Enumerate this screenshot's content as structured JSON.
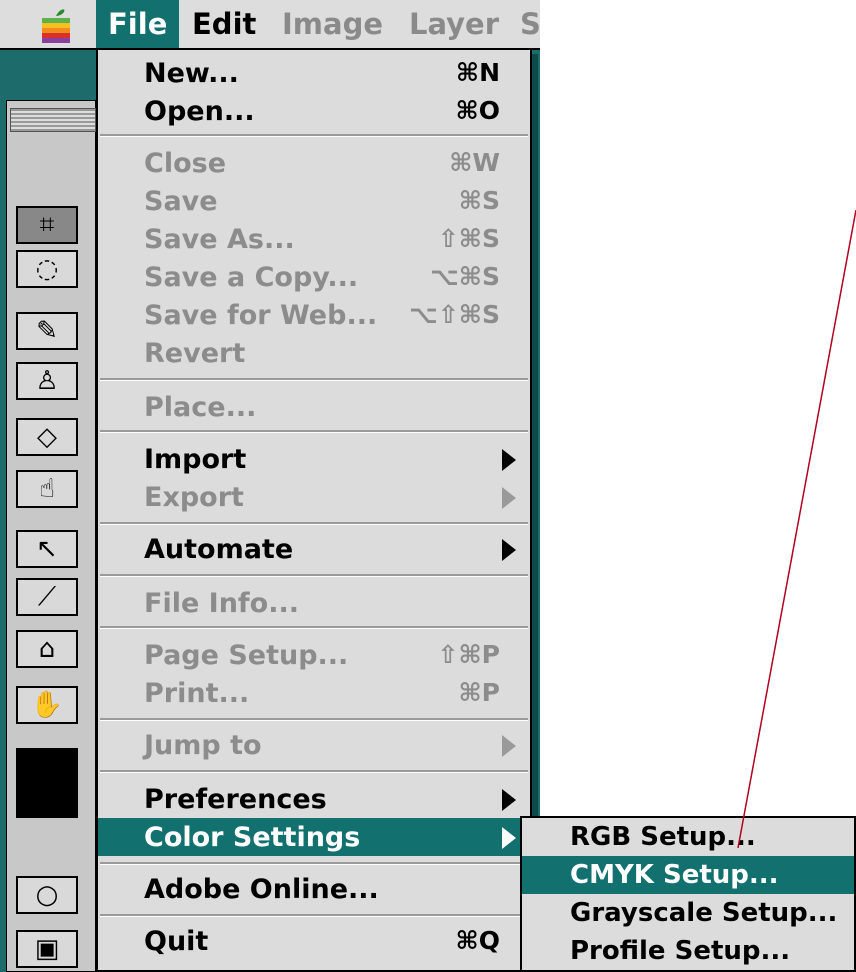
{
  "menubar": {
    "items": [
      {
        "label": "File",
        "state": "active"
      },
      {
        "label": "Edit",
        "state": "enabled"
      },
      {
        "label": "Image",
        "state": "dim"
      },
      {
        "label": "Layer",
        "state": "dim"
      },
      {
        "label": "S",
        "state": "dim"
      }
    ]
  },
  "file_menu": {
    "items": [
      {
        "label": "New...",
        "shortcut": "⌘N",
        "enabled": true
      },
      {
        "label": "Open...",
        "shortcut": "⌘O",
        "enabled": true
      },
      {
        "label": "Close",
        "shortcut": "⌘W",
        "enabled": false
      },
      {
        "label": "Save",
        "shortcut": "⌘S",
        "enabled": false
      },
      {
        "label": "Save As...",
        "shortcut": "⇧⌘S",
        "enabled": false
      },
      {
        "label": "Save a Copy...",
        "shortcut": "⌥⌘S",
        "enabled": false
      },
      {
        "label": "Save for Web...",
        "shortcut": "⌥⇧⌘S",
        "enabled": false
      },
      {
        "label": "Revert",
        "shortcut": "",
        "enabled": false
      },
      {
        "label": "Place...",
        "shortcut": "",
        "enabled": false
      },
      {
        "label": "Import",
        "shortcut": "",
        "enabled": true,
        "submenu": true
      },
      {
        "label": "Export",
        "shortcut": "",
        "enabled": false,
        "submenu": true
      },
      {
        "label": "Automate",
        "shortcut": "",
        "enabled": true,
        "submenu": true
      },
      {
        "label": "File Info...",
        "shortcut": "",
        "enabled": false
      },
      {
        "label": "Page Setup...",
        "shortcut": "⇧⌘P",
        "enabled": false
      },
      {
        "label": "Print...",
        "shortcut": "⌘P",
        "enabled": false
      },
      {
        "label": "Jump to",
        "shortcut": "",
        "enabled": false,
        "submenu": true
      },
      {
        "label": "Preferences",
        "shortcut": "",
        "enabled": true,
        "submenu": true
      },
      {
        "label": "Color Settings",
        "shortcut": "",
        "enabled": true,
        "submenu": true,
        "highlighted": true
      },
      {
        "label": "Adobe Online...",
        "shortcut": "",
        "enabled": true
      },
      {
        "label": "Quit",
        "shortcut": "⌘Q",
        "enabled": true
      }
    ]
  },
  "color_settings_submenu": {
    "items": [
      {
        "label": "RGB Setup...",
        "highlighted": false
      },
      {
        "label": "CMYK Setup...",
        "highlighted": true
      },
      {
        "label": "Grayscale Setup...",
        "highlighted": false
      },
      {
        "label": "Profile Setup...",
        "highlighted": false
      }
    ]
  },
  "colors": {
    "highlight": "#12706e",
    "menu_bg": "#dcdcdc",
    "disabled_text": "#8c8c8c",
    "annotation_line": "#b00020"
  },
  "tools": [
    "crop-tool-icon",
    "lasso-tool-icon",
    "pencil-tool-icon",
    "stamp-tool-icon",
    "eraser-tool-icon",
    "smudge-tool-icon",
    "pointer-tool-icon",
    "measure-tool-icon",
    "bucket-tool-icon",
    "hand-tool-icon"
  ]
}
